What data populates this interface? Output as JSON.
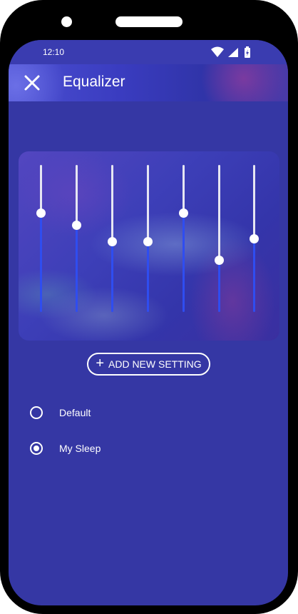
{
  "status_bar": {
    "time": "12:10",
    "icons": [
      "wifi-icon",
      "cellular-signal-icon",
      "battery-charging-icon"
    ]
  },
  "app_bar": {
    "title": "Equalizer",
    "close_icon": "close-icon"
  },
  "equalizer": {
    "bands": [
      {
        "level": 0.67
      },
      {
        "level": 0.59
      },
      {
        "level": 0.48
      },
      {
        "level": 0.48
      },
      {
        "level": 0.67
      },
      {
        "level": 0.35
      },
      {
        "level": 0.5
      }
    ]
  },
  "add_setting": {
    "label": "ADD NEW SETTING",
    "icon": "plus-icon"
  },
  "presets": [
    {
      "label": "Default",
      "selected": false
    },
    {
      "label": "My Sleep",
      "selected": true
    }
  ],
  "colors": {
    "screen_bg": "#3537a4",
    "slider_active": "#2f4df0",
    "slider_inactive": "#e6e6f2"
  }
}
